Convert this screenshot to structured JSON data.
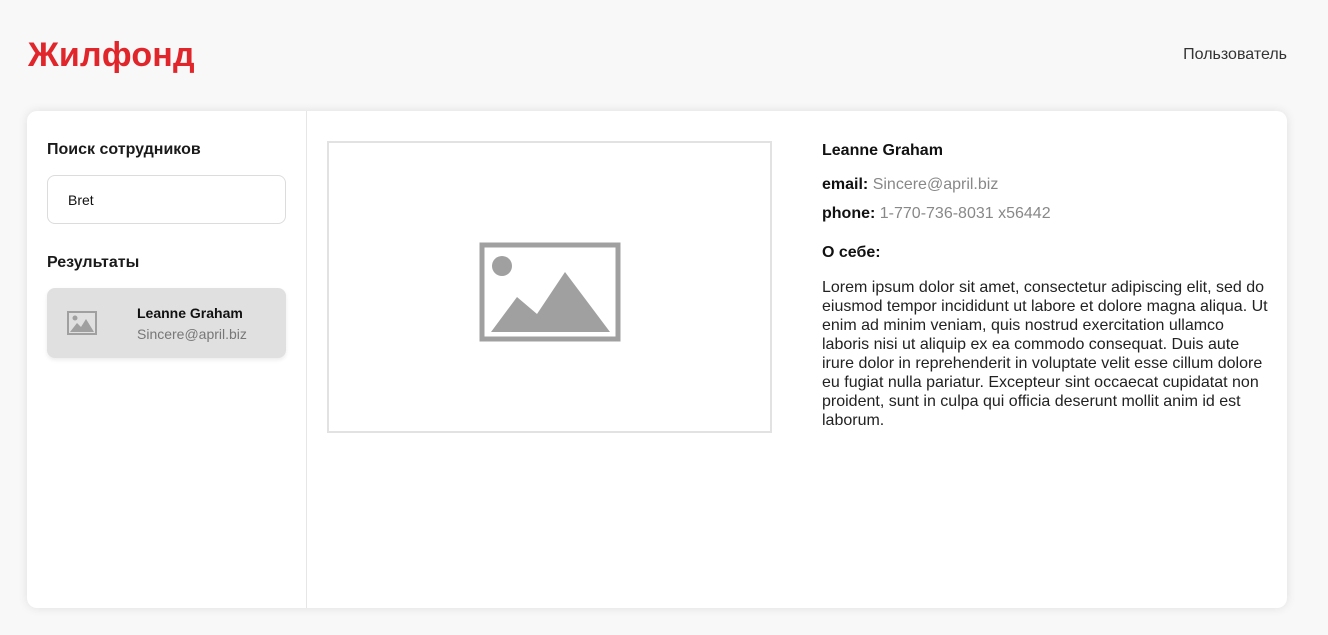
{
  "header": {
    "logo": "Жилфонд",
    "user_link": "Пользователь"
  },
  "sidebar": {
    "title": "Поиск сотрудников",
    "search_value": "Bret",
    "results_title": "Результаты",
    "results": [
      {
        "name": "Leanne Graham",
        "email": "Sincere@april.biz"
      }
    ]
  },
  "profile": {
    "photo_icon": "image-placeholder-icon",
    "name": "Leanne Graham",
    "email_label": "email:",
    "email_value": "Sincere@april.biz",
    "phone_label": "phone:",
    "phone_value": "1-770-736-8031 x56442",
    "about_title": "О себе:",
    "about_text": "Lorem ipsum dolor sit amet, consectetur adipiscing elit, sed do eiusmod tempor incididunt ut labore et dolore magna aliqua. Ut enim ad minim veniam, quis nostrud exercitation ullamco laboris nisi ut aliquip ex ea commodo consequat. Duis aute irure dolor in reprehenderit in voluptate velit esse cillum dolore eu fugiat nulla pariatur. Excepteur sint occaecat cupidatat non proident, sunt in culpa qui officia deserunt mollit anim id est laborum."
  },
  "colors": {
    "brand": "#e0262b",
    "page_background": "#f8f8f8",
    "result_selected_bg": "#e0e0e0",
    "muted_text": "#888888",
    "placeholder_icon": "#a0a0a0"
  }
}
